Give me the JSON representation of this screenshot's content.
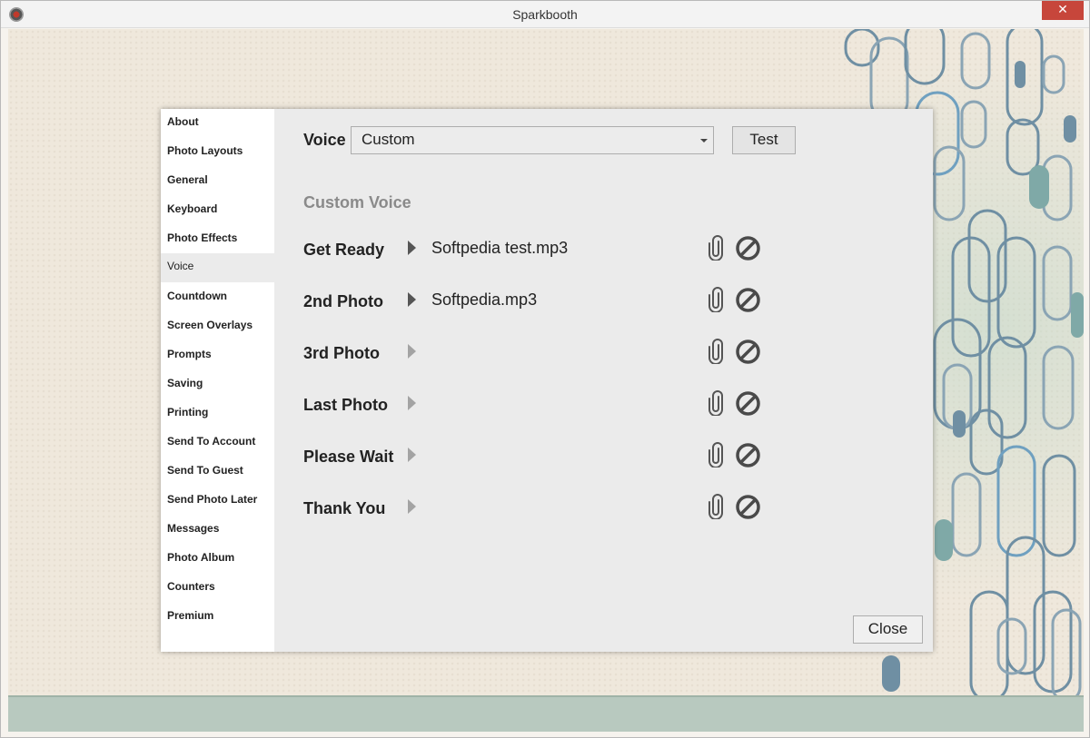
{
  "window": {
    "title": "Sparkbooth",
    "close_glyph": "✕"
  },
  "sidebar": {
    "items": [
      {
        "label": "About"
      },
      {
        "label": "Photo Layouts"
      },
      {
        "label": "General"
      },
      {
        "label": "Keyboard"
      },
      {
        "label": "Photo Effects"
      },
      {
        "label": "Voice",
        "active": true
      },
      {
        "label": "Countdown"
      },
      {
        "label": "Screen Overlays"
      },
      {
        "label": "Prompts"
      },
      {
        "label": "Saving"
      },
      {
        "label": "Printing"
      },
      {
        "label": "Send To Account"
      },
      {
        "label": "Send To Guest"
      },
      {
        "label": "Send Photo Later"
      },
      {
        "label": "Messages"
      },
      {
        "label": "Photo Album"
      },
      {
        "label": "Counters"
      },
      {
        "label": "Premium"
      }
    ]
  },
  "voice": {
    "label": "Voice",
    "selected": "Custom",
    "test_label": "Test"
  },
  "custom_voice": {
    "title": "Custom Voice",
    "rows": [
      {
        "label": "Get Ready",
        "file": "Softpedia test.mp3",
        "play_icon": "play-icon",
        "attach_icon": "paperclip-icon",
        "clear_icon": "no-entry-icon"
      },
      {
        "label": "2nd Photo",
        "file": "Softpedia.mp3",
        "play_icon": "play-icon",
        "attach_icon": "paperclip-icon",
        "clear_icon": "no-entry-icon"
      },
      {
        "label": "3rd Photo",
        "file": "",
        "play_icon": "play-icon",
        "attach_icon": "paperclip-icon",
        "clear_icon": "no-entry-icon"
      },
      {
        "label": "Last Photo",
        "file": "",
        "play_icon": "play-icon",
        "attach_icon": "paperclip-icon",
        "clear_icon": "no-entry-icon"
      },
      {
        "label": "Please Wait",
        "file": "",
        "play_icon": "play-icon",
        "attach_icon": "paperclip-icon",
        "clear_icon": "no-entry-icon"
      },
      {
        "label": "Thank You",
        "file": "",
        "play_icon": "play-icon",
        "attach_icon": "paperclip-icon",
        "clear_icon": "no-entry-icon"
      }
    ]
  },
  "footer": {
    "close_label": "Close"
  },
  "colors": {
    "titlebar_close": "#c7463b",
    "dialog_bg": "#ebebeb",
    "sidebar_bg": "#ffffff",
    "section_title": "#8a8a8a",
    "deco_blue": "#6f8fa3",
    "deco_teal": "#7fa9a7"
  }
}
